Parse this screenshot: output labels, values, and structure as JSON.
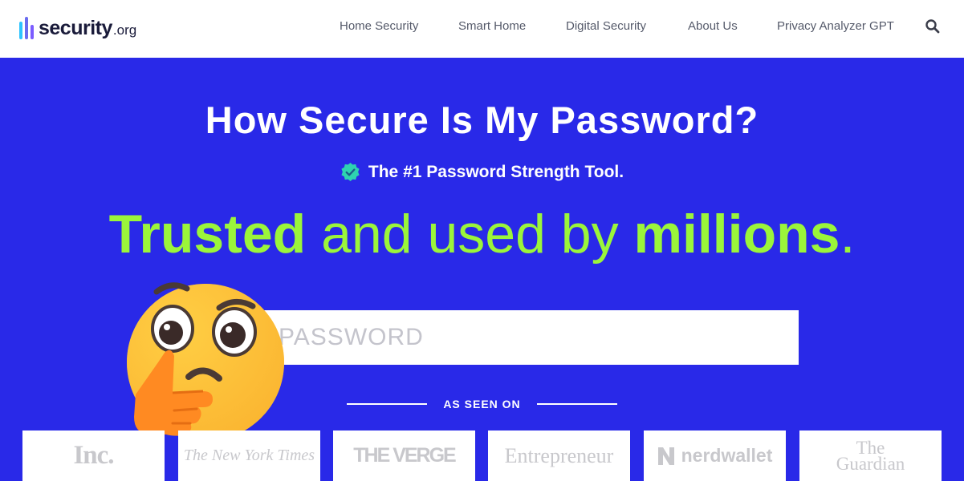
{
  "brand": {
    "name": "security",
    "tld": ".org",
    "colors": [
      "#7b5cff",
      "#2ec4ff",
      "#6a6cf0",
      "#9fa3ff"
    ]
  },
  "nav": {
    "items": [
      {
        "label": "Home Security"
      },
      {
        "label": "Smart Home"
      },
      {
        "label": "Digital Security"
      },
      {
        "label": "About Us"
      },
      {
        "label": "Privacy Analyzer GPT"
      }
    ],
    "search_icon": "search-icon"
  },
  "hero": {
    "title": "How Secure Is My Password?",
    "badge_icon": "verified-check-icon",
    "badge_text": "The #1 Password Strength Tool.",
    "tagline": {
      "part1": "Trusted",
      "part2": " and used by ",
      "part3": "millions",
      "part4": "."
    },
    "password_placeholder": "PASSWORD",
    "emoji": "thinking-face-emoji",
    "seen_on": "AS SEEN ON",
    "background_color": "#2929e8",
    "accent_color": "#9bf53a"
  },
  "press": [
    {
      "name": "Inc."
    },
    {
      "name": "The New York Times"
    },
    {
      "name": "THE VERGE"
    },
    {
      "name": "Entrepreneur"
    },
    {
      "name": "nerdwallet"
    },
    {
      "name": "The\nGuardian"
    }
  ]
}
